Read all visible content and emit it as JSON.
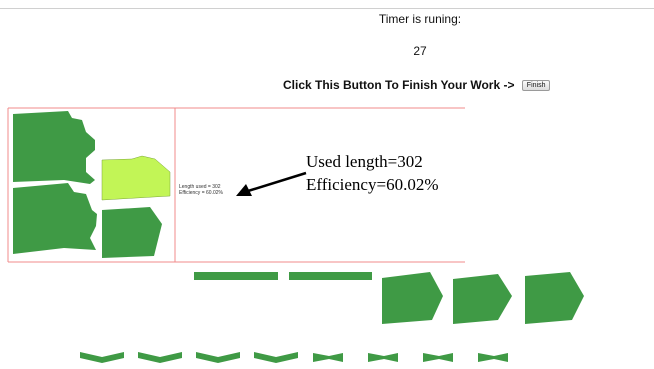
{
  "timer": {
    "label": "Timer is runing:",
    "value": "27"
  },
  "finish": {
    "prompt": "Click This Button To Finish Your Work ->",
    "button_label": "Finish"
  },
  "layout_stats": {
    "length_used": "Length used = 302",
    "efficiency": "Efficiency = 60.02%"
  },
  "annotation": {
    "line1": "Used length=302",
    "line2": "Efficiency=60.02%"
  },
  "colors": {
    "piece": "#3f9a45",
    "selected_piece": "#c2f556",
    "board_border": "#f08b8b"
  }
}
